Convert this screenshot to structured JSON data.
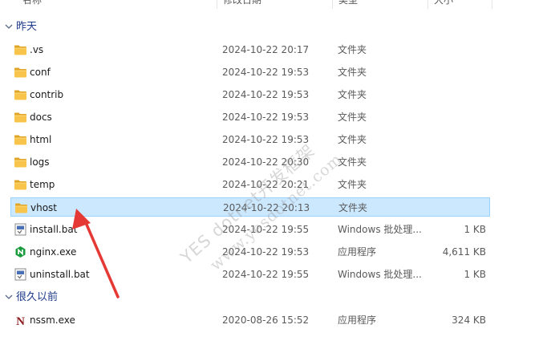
{
  "header": {
    "col_name": "名称",
    "col_date": "修改日期",
    "col_type": "类型",
    "col_size": "大小"
  },
  "groups": [
    {
      "label": "昨天",
      "items": [
        {
          "name": ".vs",
          "date": "2024-10-22 20:17",
          "type": "文件夹",
          "size": "",
          "icon": "folder-icon"
        },
        {
          "name": "conf",
          "date": "2024-10-22 19:53",
          "type": "文件夹",
          "size": "",
          "icon": "folder-icon"
        },
        {
          "name": "contrib",
          "date": "2024-10-22 19:53",
          "type": "文件夹",
          "size": "",
          "icon": "folder-icon"
        },
        {
          "name": "docs",
          "date": "2024-10-22 19:53",
          "type": "文件夹",
          "size": "",
          "icon": "folder-icon"
        },
        {
          "name": "html",
          "date": "2024-10-22 19:53",
          "type": "文件夹",
          "size": "",
          "icon": "folder-icon"
        },
        {
          "name": "logs",
          "date": "2024-10-22 20:30",
          "type": "文件夹",
          "size": "",
          "icon": "folder-icon"
        },
        {
          "name": "temp",
          "date": "2024-10-22 20:21",
          "type": "文件夹",
          "size": "",
          "icon": "folder-icon"
        },
        {
          "name": "vhost",
          "date": "2024-10-22 20:13",
          "type": "文件夹",
          "size": "",
          "icon": "folder-icon",
          "selected": true
        },
        {
          "name": "install.bat",
          "date": "2024-10-22 19:55",
          "type": "Windows 批处理...",
          "size": "1 KB",
          "icon": "batch-file-icon"
        },
        {
          "name": "nginx.exe",
          "date": "2024-10-22 19:53",
          "type": "应用程序",
          "size": "4,611 KB",
          "icon": "nginx-app-icon"
        },
        {
          "name": "uninstall.bat",
          "date": "2024-10-22 19:55",
          "type": "Windows 批处理...",
          "size": "1 KB",
          "icon": "batch-file-icon"
        }
      ]
    },
    {
      "label": "很久以前",
      "items": [
        {
          "name": "nssm.exe",
          "date": "2020-08-26 15:52",
          "type": "应用程序",
          "size": "324 KB",
          "icon": "nssm-app-icon"
        }
      ]
    }
  ],
  "watermark": {
    "line1": "YES dotnet开发框架",
    "line2": "www.yesdotnet.com"
  },
  "colors": {
    "selection_bg": "#cce8ff",
    "selection_border": "#99d1ff",
    "group_header": "#1e3a8a",
    "folder": "#f8c44b",
    "arrow": "#e53935"
  }
}
